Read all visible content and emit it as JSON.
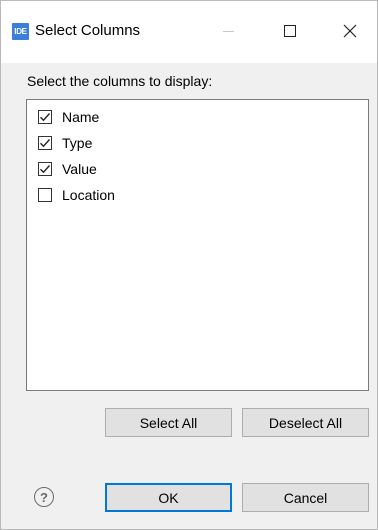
{
  "window": {
    "title": "Select Columns",
    "app_icon_text": "IDE"
  },
  "instruction": "Select the columns to display:",
  "columns": [
    {
      "label": "Name",
      "checked": true
    },
    {
      "label": "Type",
      "checked": true
    },
    {
      "label": "Value",
      "checked": true
    },
    {
      "label": "Location",
      "checked": false
    }
  ],
  "buttons": {
    "select_all": "Select All",
    "deselect_all": "Deselect All",
    "ok": "OK",
    "cancel": "Cancel"
  },
  "help_icon": "?",
  "icons": {
    "app": "ide-icon",
    "minimize": "minimize-icon",
    "maximize": "maximize-icon",
    "close": "close-icon",
    "help": "help-icon",
    "checkmark": "checkmark-icon"
  },
  "colors": {
    "accent": "#0078d7",
    "app_icon": "#3b7fd8"
  }
}
